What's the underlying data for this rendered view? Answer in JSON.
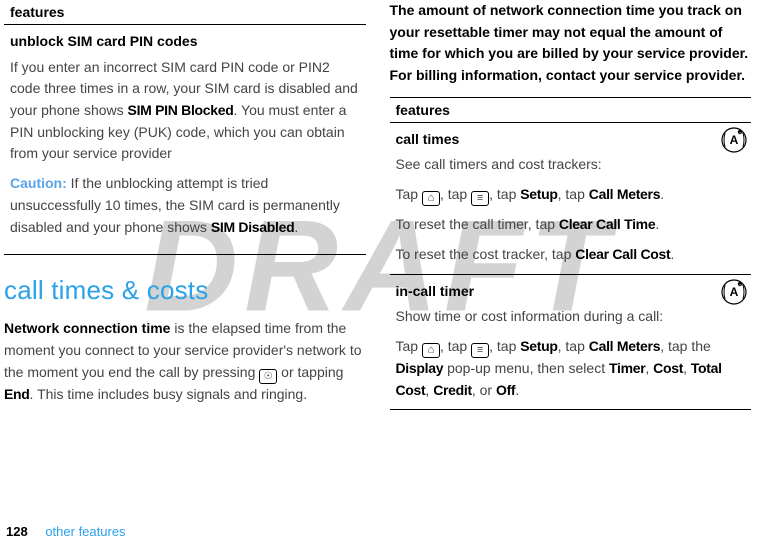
{
  "watermark": "DRAFT",
  "left": {
    "features_header": "features",
    "row_title": "unblock SIM card PIN codes",
    "p1a": "If you enter an incorrect SIM card PIN code or PIN2 code three times in a row, your SIM card is disabled and your phone shows ",
    "p1b": "SIM PIN Blocked",
    "p1c": ". You must enter a PIN unblocking key (PUK) code, which you can obtain from your service provider",
    "caution_label": "Caution:",
    "p2a": " If the unblocking attempt is tried unsuccessfully 10 times, the SIM card is permanently disabled and your phone shows ",
    "p2b": "SIM Disabled",
    "p2c": ".",
    "section_heading": "call times & costs",
    "body1_a": "Network connection time",
    "body1_b": " is the elapsed time from the moment you connect to your service provider's network to the moment you end the call by pressing ",
    "body1_c": " or tapping ",
    "body1_d": "End",
    "body1_e": ". This time includes busy signals and ringing."
  },
  "right": {
    "top_para": "The amount of network connection time you track on your resettable timer may not equal the amount of time for which you are billed by your service provider. For billing information, contact your service provider.",
    "features_header": "features",
    "row1_title": "call times",
    "row1_p1": "See call timers and cost trackers:",
    "row1_tap": "Tap ",
    "row1_tap2": ", tap ",
    "row1_tap3": ", tap ",
    "row1_setup": "Setup",
    "row1_tap4": ", tap ",
    "row1_cm": "Call Meters",
    "row1_dot": ".",
    "row1_reset1a": "To reset the call timer, tap ",
    "row1_reset1b": "Clear Call Time",
    "row1_reset2a": "To reset the cost tracker, tap ",
    "row1_reset2b": "Clear Call Cost",
    "row2_title": "in-call timer",
    "row2_p1": "Show time or cost information during a call:",
    "row2_a": "Tap ",
    "row2_b": ", tap ",
    "row2_c": ", tap ",
    "row2_setup": "Setup",
    "row2_d": ", tap ",
    "row2_cm": "Call Meters",
    "row2_e": ", tap the ",
    "row2_disp": "Display",
    "row2_f": " pop-up menu, then select ",
    "row2_t": "Timer",
    "row2_g": ", ",
    "row2_cost": "Cost",
    "row2_h": ", ",
    "row2_tc": "Total Cost",
    "row2_i": ", ",
    "row2_cr": "Credit",
    "row2_j": ", or ",
    "row2_off": "Off",
    "row2_k": "."
  },
  "footer": {
    "page": "128",
    "section": "other features"
  }
}
